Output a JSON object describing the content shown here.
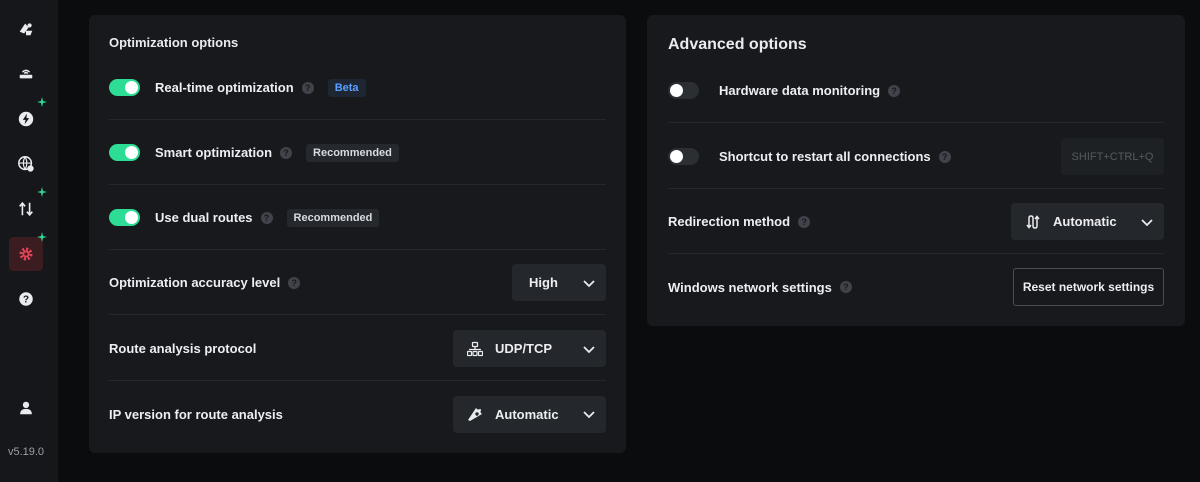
{
  "app": {
    "version": "v5.19.0"
  },
  "sidebar": {
    "items": [
      {
        "icon": "rocket-icon",
        "active": false,
        "badge": false
      },
      {
        "icon": "router-icon",
        "active": false,
        "badge": false
      },
      {
        "icon": "lightning-icon",
        "active": false,
        "badge": true
      },
      {
        "icon": "globe-icon",
        "active": false,
        "badge": false
      },
      {
        "icon": "transfer-icon",
        "active": false,
        "badge": true
      },
      {
        "icon": "gear-icon",
        "active": true,
        "badge": true
      },
      {
        "icon": "help-icon",
        "active": false,
        "badge": false
      },
      {
        "icon": "user-icon",
        "active": false,
        "badge": false
      }
    ],
    "colors": {
      "badge": "#2ddc95",
      "active": "#e04456"
    }
  },
  "optimization": {
    "title": "Optimization options",
    "realtime": {
      "label": "Real-time optimization",
      "badge": "Beta",
      "enabled": true
    },
    "smart": {
      "label": "Smart optimization",
      "badge": "Recommended",
      "enabled": true
    },
    "dual": {
      "label": "Use dual routes",
      "badge": "Recommended",
      "enabled": true
    },
    "accuracy": {
      "label": "Optimization accuracy level",
      "value": "High"
    },
    "protocol": {
      "label": "Route analysis protocol",
      "value": "UDP/TCP"
    },
    "ipversion": {
      "label": "IP version for route analysis",
      "value": "Automatic"
    }
  },
  "advanced": {
    "title": "Advanced options",
    "hardware": {
      "label": "Hardware data monitoring",
      "enabled": false
    },
    "shortcut": {
      "label": "Shortcut to restart all connections",
      "enabled": false,
      "keys": "SHIFT+CTRL+Q"
    },
    "redirection": {
      "label": "Redirection method",
      "value": "Automatic"
    },
    "network": {
      "label": "Windows network settings",
      "button": "Reset network settings"
    }
  },
  "help_glyph": "?",
  "colors": {
    "accent": "#2ddc95",
    "beta": "#5aa0ff"
  }
}
